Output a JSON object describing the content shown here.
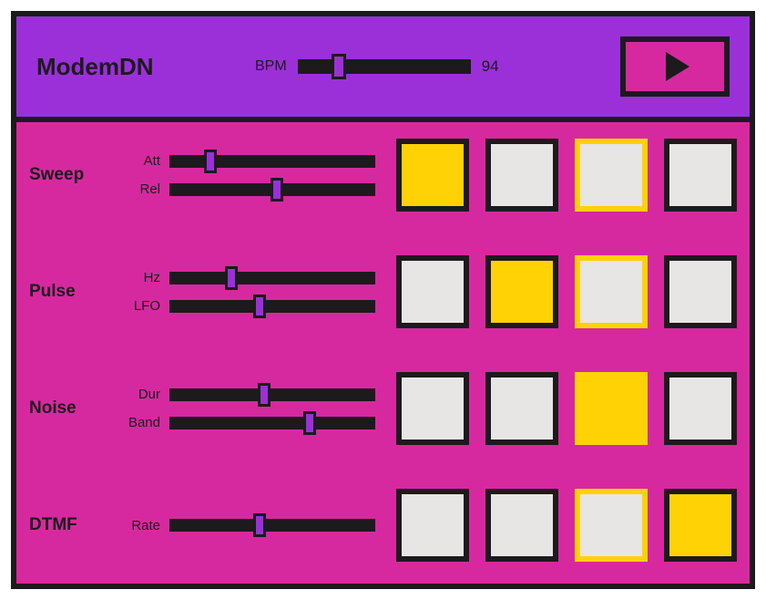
{
  "title": "ModemDN",
  "toolbar": {
    "bpm_label": "BPM",
    "bpm_value": "94",
    "bpm_pct": 24,
    "play_icon": "play-icon"
  },
  "playhead_col": 2,
  "tracks": [
    {
      "name": "Sweep",
      "params": [
        {
          "label": "Att",
          "pct": 20
        },
        {
          "label": "Rel",
          "pct": 52
        }
      ],
      "steps": [
        true,
        false,
        false,
        false
      ]
    },
    {
      "name": "Pulse",
      "params": [
        {
          "label": "Hz",
          "pct": 30
        },
        {
          "label": "LFO",
          "pct": 44
        }
      ],
      "steps": [
        false,
        true,
        false,
        false
      ]
    },
    {
      "name": "Noise",
      "params": [
        {
          "label": "Dur",
          "pct": 46
        },
        {
          "label": "Band",
          "pct": 68
        }
      ],
      "steps": [
        false,
        false,
        true,
        false
      ]
    },
    {
      "name": "DTMF",
      "params": [
        {
          "label": "Rate",
          "pct": 44
        }
      ],
      "steps": [
        false,
        false,
        false,
        true
      ]
    }
  ]
}
